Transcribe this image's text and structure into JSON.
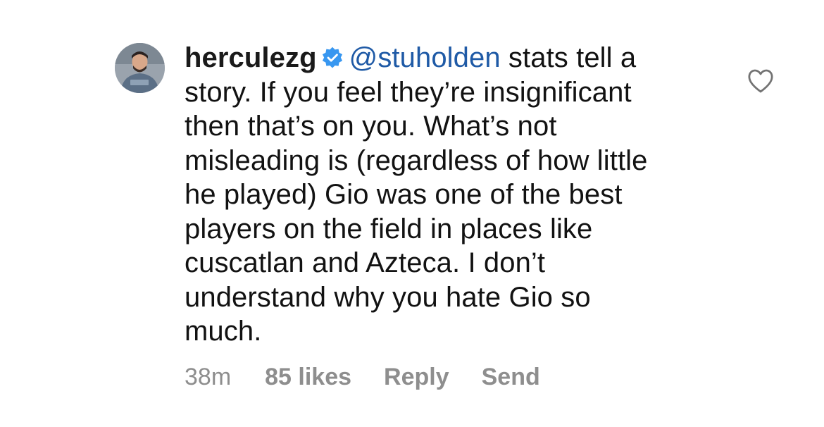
{
  "comment": {
    "username": "herculezg",
    "verified_icon": "verified-badge-icon",
    "mention": "@stuholden",
    "first_line_rest": " stats tell a",
    "lines": [
      "story. If you feel they’re insignificant",
      "then that’s on you. What’s not",
      "misleading is (regardless of how little",
      "he played) Gio was one of the best",
      "players on the field in places like",
      "cuscatlan and Azteca. I don’t",
      "understand why you hate Gio so",
      "much."
    ],
    "like_icon": "heart-outline-icon",
    "avatar_icon": "profile-avatar"
  },
  "footer": {
    "time": "38m",
    "likes": "85 likes",
    "reply": "Reply",
    "send": "Send"
  },
  "colors": {
    "mention": "#1f5aa6",
    "verified": "#3897f0",
    "meta": "#8e8e8e",
    "text": "#121212"
  }
}
